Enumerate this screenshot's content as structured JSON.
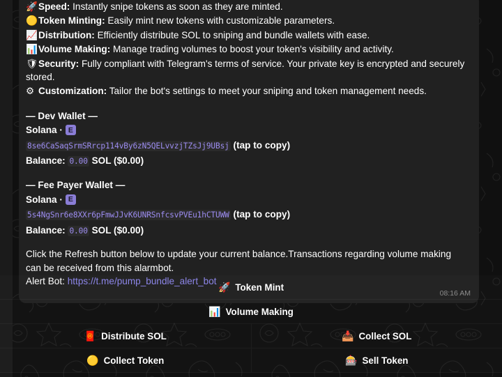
{
  "message": {
    "features": [
      {
        "icon": "🚀",
        "icon_name": "rocket-icon",
        "title": "Speed:",
        "text": " Instantly snipe tokens as soon as they are minted."
      },
      {
        "icon": "🟡",
        "icon_name": "yellow-circle-icon",
        "title": "Token Minting:",
        "text": " Easily mint new tokens with customizable parameters."
      },
      {
        "icon": "📈",
        "icon_name": "chart-increasing-icon",
        "title": "Distribution:",
        "text": " Efficiently distribute SOL to sniping and bundle wallets with ease."
      },
      {
        "icon": "📊",
        "icon_name": "bar-chart-icon",
        "title": "Volume Making:",
        "text": " Manage trading volumes to boost your token's visibility and activity."
      },
      {
        "icon": "🛡",
        "icon_name": "shield-icon",
        "title": "Security:",
        "text": " Fully compliant with Telegram's terms of service. Your private key is encrypted and securely stored."
      },
      {
        "icon": "⚙",
        "icon_name": "gear-icon",
        "title": "Customization:",
        "text": " Tailor the bot's settings to meet your sniping and token management needs."
      }
    ],
    "wallets": [
      {
        "heading": "— Dev Wallet —",
        "chain": "Solana ·",
        "chain_badge": "E",
        "address": "8se6CaSaqSrmSRrcp114vBy6zN5QELvvzjTZsJj9UBsj",
        "copy_hint": "(tap to copy)",
        "balance_label": "Balance:",
        "balance_value": "0.00",
        "balance_unit": "SOL ($0.00)"
      },
      {
        "heading": "— Fee Payer Wallet —",
        "chain": "Solana ·",
        "chain_badge": "E",
        "address": "5s4NgSnr6e8XXr6pFmwJJvK6UNRSnfcsvPVEu1hCTUWW",
        "copy_hint": "(tap to copy)",
        "balance_label": "Balance:",
        "balance_value": "0.00",
        "balance_unit": "SOL ($0.00)"
      }
    ],
    "footer_line1": "Click the Refresh button below to update your current balance.Transactions regarding volume making",
    "footer_line2": "can be received from this alarmbot.",
    "alert_label": "Alert Bot:",
    "alert_url": "https://t.me/pump_bundle_alert_bot",
    "timestamp": "08:16 AM"
  },
  "keyboard": {
    "rows": [
      [
        {
          "icon": "🚀",
          "icon_name": "rocket-icon",
          "label": "Token Mint"
        }
      ],
      [
        {
          "icon": "📊",
          "icon_name": "bar-chart-icon",
          "label": "Volume Making"
        }
      ],
      [
        {
          "icon": "🧧",
          "icon_name": "red-envelope-icon",
          "label": "Distribute SOL"
        },
        {
          "icon": "📥",
          "icon_name": "inbox-tray-icon",
          "label": "Collect SOL"
        }
      ],
      [
        {
          "icon": "🟡",
          "icon_name": "yellow-circle-icon",
          "label": "Collect Token"
        },
        {
          "icon": "🎰",
          "icon_name": "slot-machine-icon",
          "label": "Sell Token"
        }
      ]
    ]
  },
  "colors": {
    "bubble_bg": "#212121",
    "page_bg": "#101010",
    "link": "#8b84e8",
    "code_text": "#9d8df1",
    "badge_bg": "#8a7dd6",
    "timestamp": "#8b8b8b"
  }
}
